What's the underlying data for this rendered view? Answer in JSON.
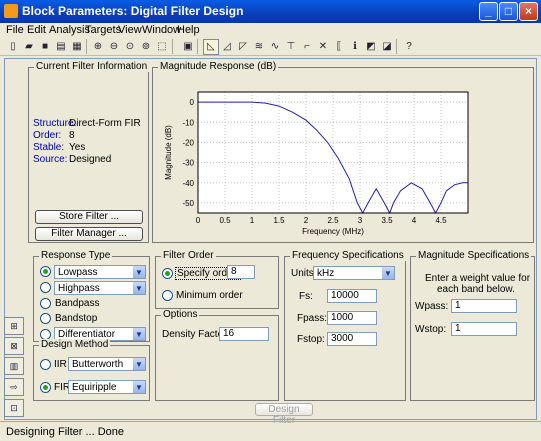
{
  "window": {
    "title": "Block Parameters: Digital Filter Design"
  },
  "menu": [
    "File",
    "Edit",
    "Analysis",
    "Targets",
    "View",
    "Window",
    "Help"
  ],
  "toolbar": {
    "icons": [
      "new-icon",
      "open-icon",
      "save-icon",
      "print-icon",
      "print-preview-icon",
      "zoom-in-icon",
      "zoom-out-icon",
      "zoom-x-icon",
      "zoom-y-icon",
      "full-view-icon",
      "magnitude-icon",
      "phase-icon",
      "mag-phase-icon",
      "group-delay-icon",
      "phase-delay-icon",
      "impulse-icon",
      "step-icon",
      "pole-zero-icon",
      "coefficients-icon",
      "info-icon",
      "tolerance-icon",
      "noise-icon",
      "whats-this-icon"
    ]
  },
  "filter_info": {
    "title": "Current Filter Information",
    "rows": [
      {
        "label": "Structure:",
        "value": "Direct-Form FIR"
      },
      {
        "label": "Order:",
        "value": "8"
      },
      {
        "label": "Stable:",
        "value": "Yes"
      },
      {
        "label": "Source:",
        "value": "Designed"
      }
    ],
    "store_button": "Store Filter ...",
    "manager_button": "Filter Manager ..."
  },
  "magnitude_panel": {
    "title": "Magnitude Response (dB)"
  },
  "chart_data": {
    "type": "line",
    "title": "",
    "xlabel": "Frequency (MHz)",
    "ylabel": "Magnitude (dB)",
    "xlim": [
      0,
      5
    ],
    "ylim": [
      -55,
      5
    ],
    "xticks": [
      "0",
      "0.5",
      "1",
      "1.5",
      "2",
      "2.5",
      "3",
      "3.5",
      "4",
      "4.5"
    ],
    "yticks": [
      "0",
      "-10",
      "-20",
      "-30",
      "-40",
      "-50"
    ],
    "grid": true,
    "x": [
      0,
      0.5,
      1,
      1.25,
      1.5,
      1.75,
      2,
      2.2,
      2.4,
      2.6,
      2.8,
      2.95,
      3.05,
      3.15,
      3.3,
      3.45,
      3.55,
      3.62,
      3.75,
      3.95,
      4.15,
      4.3,
      4.4,
      4.5,
      4.6,
      4.75,
      4.9,
      5
    ],
    "y": [
      0,
      0,
      0,
      -0.5,
      -2,
      -5,
      -9,
      -14,
      -20,
      -28,
      -38,
      -50,
      -55,
      -50,
      -43,
      -50,
      -55,
      -50,
      -44,
      -40,
      -43,
      -50,
      -55,
      -50,
      -44,
      -41,
      -40,
      -40
    ]
  },
  "response_type": {
    "title": "Response Type",
    "options": [
      {
        "label": "Lowpass",
        "selected": true,
        "dropdown": "Lowpass"
      },
      {
        "label": "",
        "selected": false,
        "dropdown": "Highpass"
      },
      {
        "label": "Bandpass",
        "selected": false
      },
      {
        "label": "Bandstop",
        "selected": false
      },
      {
        "label": "",
        "selected": false,
        "dropdown": "Differentiator"
      }
    ]
  },
  "design_method": {
    "title": "Design Method",
    "iir_label": "IIR",
    "iir_value": "Butterworth",
    "fir_label": "FIR",
    "fir_value": "Equiripple"
  },
  "filter_order": {
    "title": "Filter Order",
    "specify_label": "Specify order:",
    "specify_value": "8",
    "minimum_label": "Minimum order"
  },
  "options": {
    "title": "Options",
    "density_label": "Density Factor:",
    "density_value": "16"
  },
  "freq_specs": {
    "title": "Frequency Specifications",
    "units_label": "Units:",
    "units_value": "kHz",
    "fs_label": "Fs:",
    "fs_value": "10000",
    "fpass_label": "Fpass:",
    "fpass_value": "1000",
    "fstop_label": "Fstop:",
    "fstop_value": "3000"
  },
  "mag_specs": {
    "title": "Magnitude Specifications",
    "note_line1": "Enter a weight value for",
    "note_line2": "each band below.",
    "wpass_label": "Wpass:",
    "wpass_value": "1",
    "wstop_label": "Wstop:",
    "wstop_value": "1"
  },
  "design_button": "Design Filter",
  "status": "Designing Filter ... Done",
  "colors": {
    "titlebar": "#0a4fd6",
    "curve": "#2020b0",
    "panel": "#ece9d8"
  }
}
